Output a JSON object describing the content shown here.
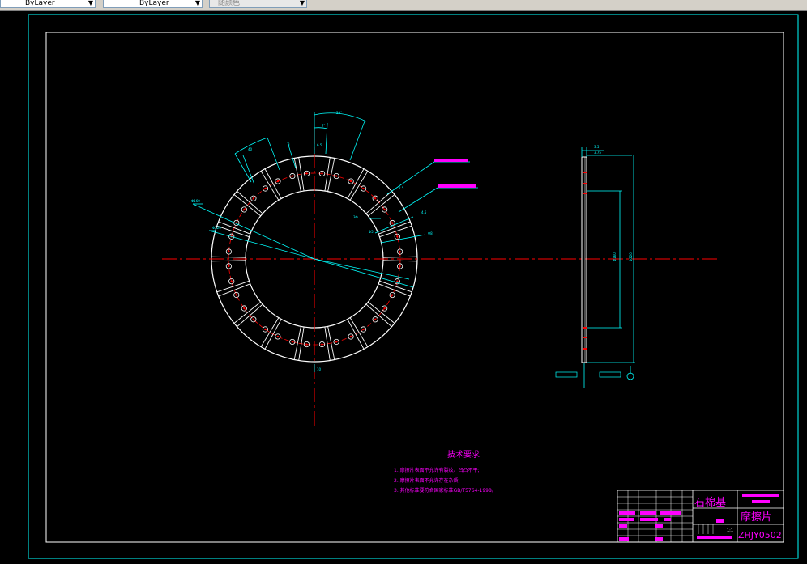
{
  "toolbar": {
    "layer_color": "ByLayer",
    "layer_linetype": "ByLayer",
    "plot_style": "随颜色"
  },
  "notes": {
    "title": "技术要求",
    "items": [
      "1. 摩擦片表面不允许有裂纹、凹凸不平;",
      "2. 摩擦片表面不允许存在杂质;",
      "3. 其他标准要符合国家标准GB/T5764-1998。"
    ]
  },
  "title_block": {
    "material": "石棉基",
    "part_name": "摩擦片",
    "drawing_no": "ZHJY0502",
    "scale": "1:1"
  },
  "colors": {
    "background": "#000000",
    "border": "#00ffff",
    "inner_border": "#ffffff",
    "dimension": "#00ffff",
    "centerline": "#ff0000",
    "text": "#ff00ff",
    "part_outline": "#ffffff"
  }
}
